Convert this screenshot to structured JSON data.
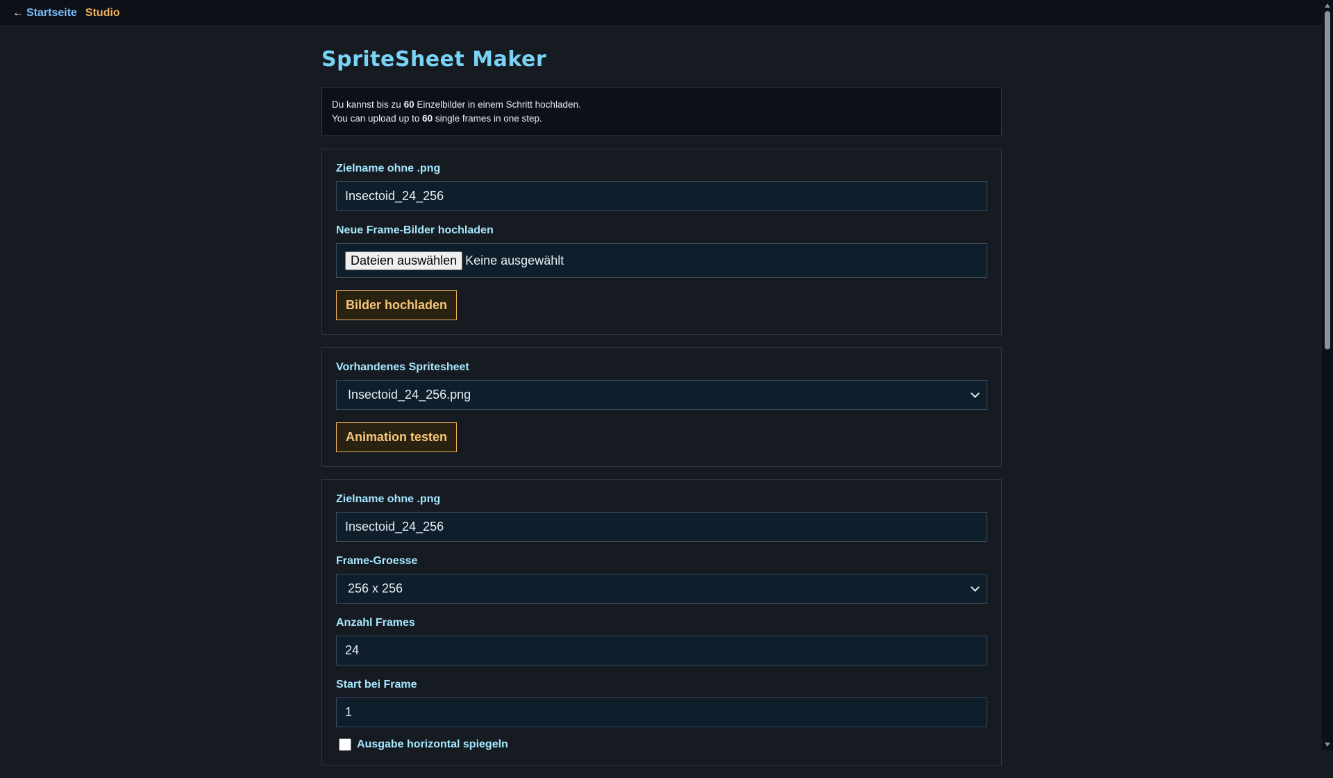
{
  "nav": {
    "back_arrow": "←",
    "home_label": "Startseite",
    "studio_label": "Studio"
  },
  "page": {
    "title": "SpriteSheet Maker"
  },
  "info": {
    "line1_pre": "Du kannst bis zu ",
    "line1_num": "60",
    "line1_post": " Einzelbilder in einem Schritt hochladen.",
    "line2_pre": "You can upload up to ",
    "line2_num": "60",
    "line2_post": " single frames in one step."
  },
  "upload": {
    "name_label": "Zielname ohne .png",
    "name_value": "Insectoid_24_256",
    "frames_label": "Neue Frame-Bilder hochladen",
    "file_button": "Dateien auswählen",
    "file_status": "Keine ausgewählt",
    "submit": "Bilder hochladen"
  },
  "existing": {
    "label": "Vorhandenes Spritesheet",
    "selected": "Insectoid_24_256.png",
    "test_button": "Animation testen"
  },
  "build": {
    "name_label": "Zielname ohne .png",
    "name_value": "Insectoid_24_256",
    "size_label": "Frame-Groesse",
    "size_value": "256 x 256",
    "count_label": "Anzahl Frames",
    "count_value": "24",
    "start_label": "Start bei Frame",
    "start_value": "1",
    "mirror_label": "Ausgabe horizontal spiegeln"
  },
  "colors": {
    "accent": "#f0b35a",
    "title": "#79d3f5",
    "label": "#a5e8ff",
    "background": "#161b22"
  }
}
